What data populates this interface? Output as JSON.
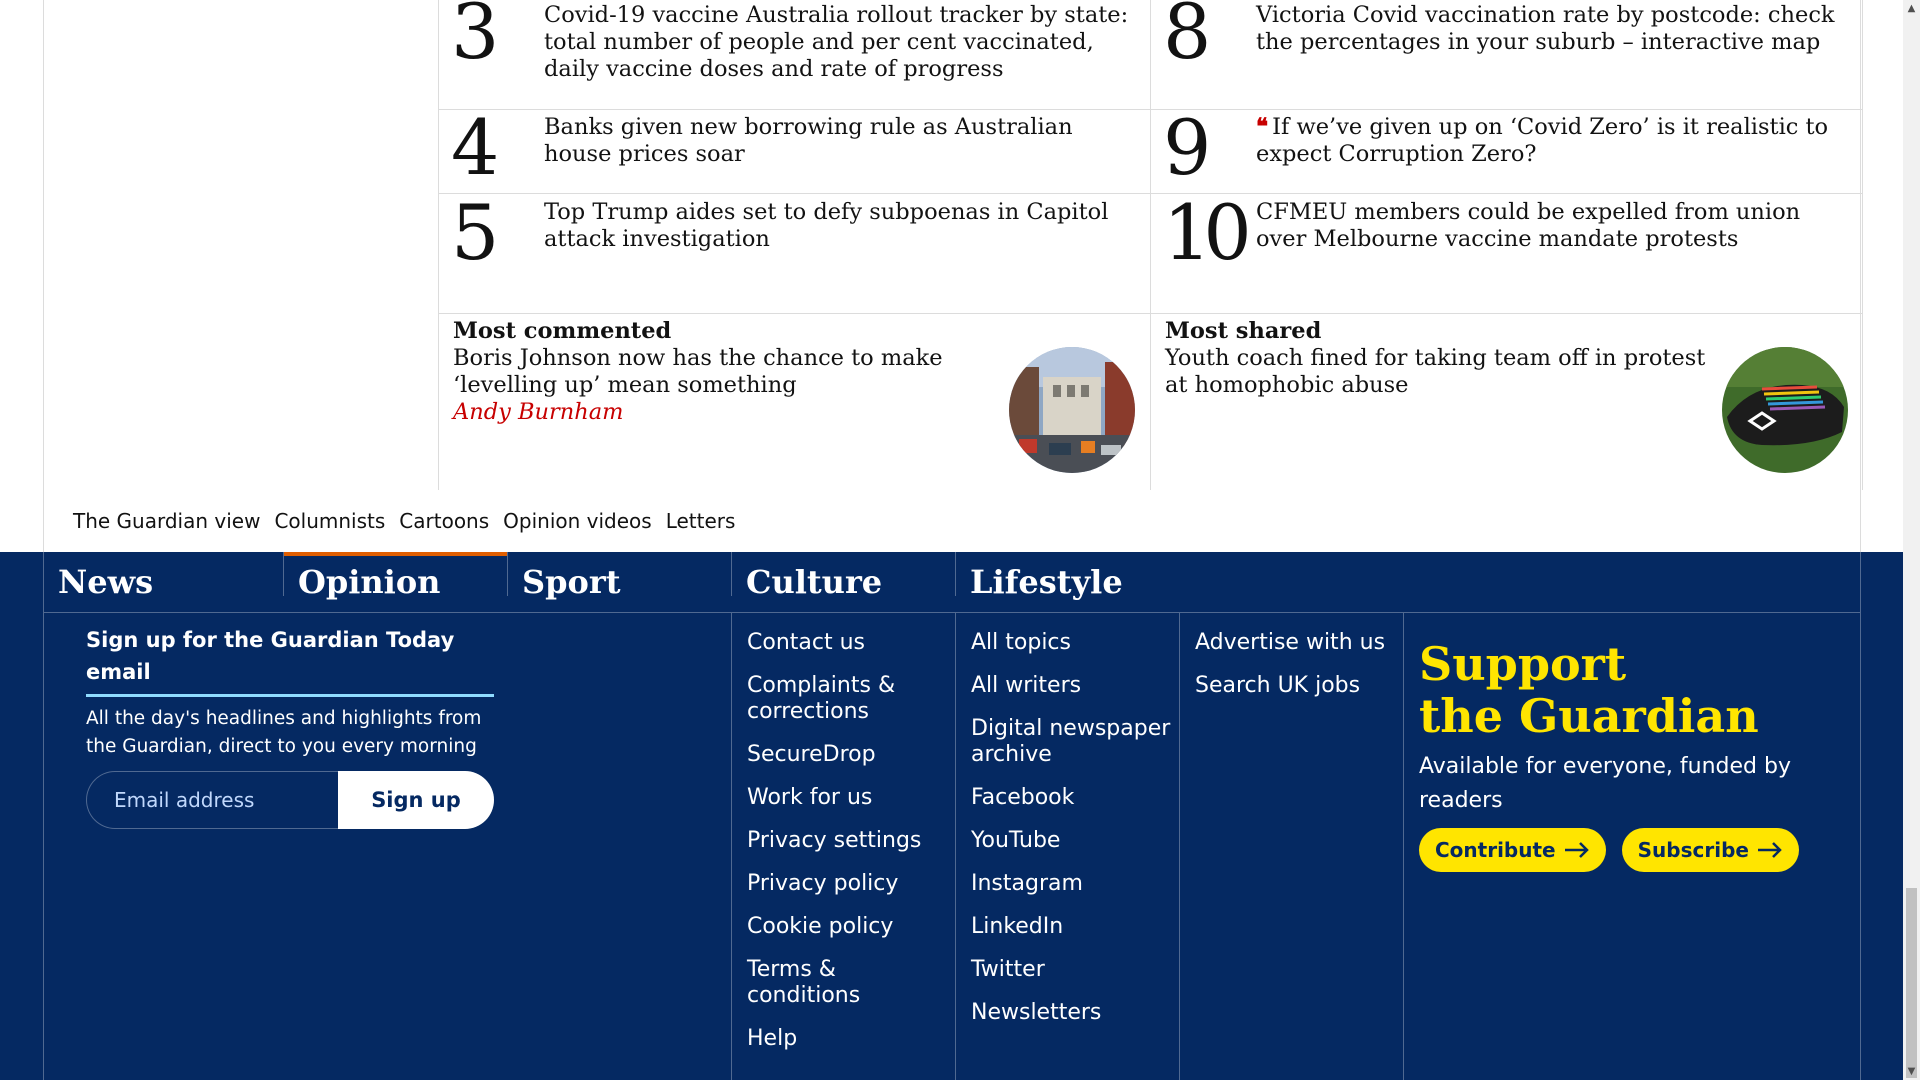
{
  "most_popular": {
    "left": [
      {
        "num": "3",
        "headline": "Covid-19 vaccine Australia rollout tracker by state: total number of people and per cent vaccinated, daily vaccine doses and rate of progress"
      },
      {
        "num": "4",
        "headline": "Banks given new borrowing rule as Australian house prices soar"
      },
      {
        "num": "5",
        "headline": "Top Trump aides set to defy subpoenas in Capitol attack investigation"
      }
    ],
    "right": [
      {
        "num": "8",
        "headline": "Victoria Covid vaccination rate by postcode: check the percentages in your suburb – interactive map"
      },
      {
        "num": "9",
        "headline": "If we’ve given up on ‘Covid Zero’ is it realistic to expect Corruption Zero?"
      },
      {
        "num": "10",
        "headline": "CFMEU members could be expelled from union over Melbourne vaccine mandate protests"
      }
    ]
  },
  "most_commented": {
    "kicker": "Most commented",
    "headline": "Boris Johnson now has the chance to make ‘levelling up’ mean something",
    "byline": "Andy Burnham"
  },
  "most_shared": {
    "kicker": "Most shared",
    "headline": "Youth coach fined for taking team off in protest at homophobic abuse"
  },
  "sub_nav": [
    "The Guardian view",
    "Columnists",
    "Cartoons",
    "Opinion videos",
    "Letters"
  ],
  "pillars": [
    "News",
    "Opinion",
    "Sport",
    "Culture",
    "Lifestyle"
  ],
  "email_signup": {
    "title": "Sign up for the Guardian Today email",
    "description": "All the day's headlines and highlights from the Guardian, direct to you every morning",
    "placeholder": "Email address",
    "button": "Sign up"
  },
  "links_col1": [
    "Contact us",
    "Complaints & corrections",
    "SecureDrop",
    "Work for us",
    "Privacy settings",
    "Privacy policy",
    "Cookie policy",
    "Terms & conditions",
    "Help"
  ],
  "links_col2": [
    "All topics",
    "All writers",
    "Digital newspaper archive",
    "Facebook",
    "YouTube",
    "Instagram",
    "LinkedIn",
    "Twitter",
    "Newsletters"
  ],
  "links_col3": [
    "Advertise with us",
    "Search UK jobs"
  ],
  "support": {
    "title_line1": "Support",
    "title_line2": "the Guardian",
    "description": "Available for everyone, funded by readers",
    "contribute": "Contribute",
    "subscribe": "Subscribe"
  },
  "colors": {
    "footer_bg": "#052962",
    "accent_yellow": "#ffe500",
    "opinion_orange": "#e05e00",
    "byline_red": "#c70000"
  }
}
